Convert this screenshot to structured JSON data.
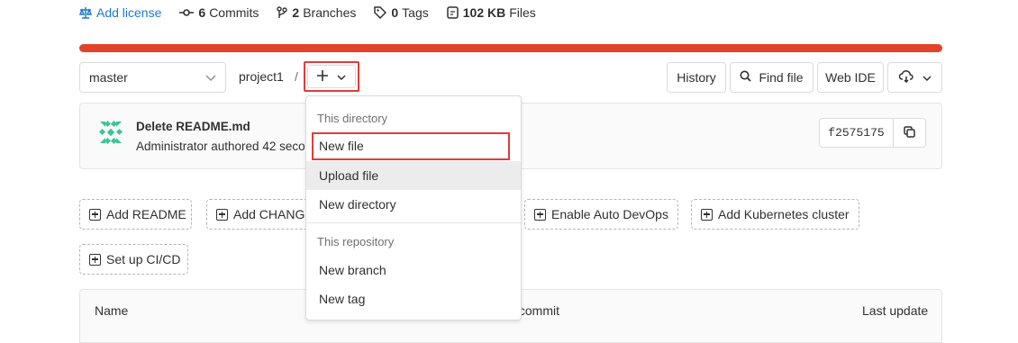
{
  "stats": {
    "license": "Add license",
    "commits_count": "6",
    "commits_label": "Commits",
    "branches_count": "2",
    "branches_label": "Branches",
    "tags_count": "0",
    "tags_label": "Tags",
    "files_size": "102 KB",
    "files_label": "Files"
  },
  "language_bar": {
    "color": "#e24329",
    "fill_percent": 100
  },
  "toolbar": {
    "branch": "master",
    "breadcrumb_project": "project1",
    "breadcrumb_separator": "/",
    "add_icon": "plus-icon",
    "history": "History",
    "find_file": "Find file",
    "web_ide": "Web IDE",
    "clone_icon": "cloud-download-icon"
  },
  "commit": {
    "title": "Delete README.md",
    "author_line": "Administrator authored 42 seconds ago",
    "sha": "f2575175"
  },
  "actions": {
    "add_readme": "Add README",
    "add_changelog": "Add CHANGELOG",
    "enable_auto_devops": "Enable Auto DevOps",
    "add_kubernetes": "Add Kubernetes cluster",
    "setup_cicd": "Set up CI/CD"
  },
  "table": {
    "col_name": "Name",
    "col_last_commit": "Last commit",
    "col_last_update": "Last update"
  },
  "dropdown": {
    "section_directory": "This directory",
    "new_file": "New file",
    "upload_file": "Upload file",
    "new_directory": "New directory",
    "section_repository": "This repository",
    "new_branch": "New branch",
    "new_tag": "New tag"
  },
  "colors": {
    "accent": "#1f78d1",
    "highlight": "#e03c3c",
    "brand": "#e24329"
  }
}
